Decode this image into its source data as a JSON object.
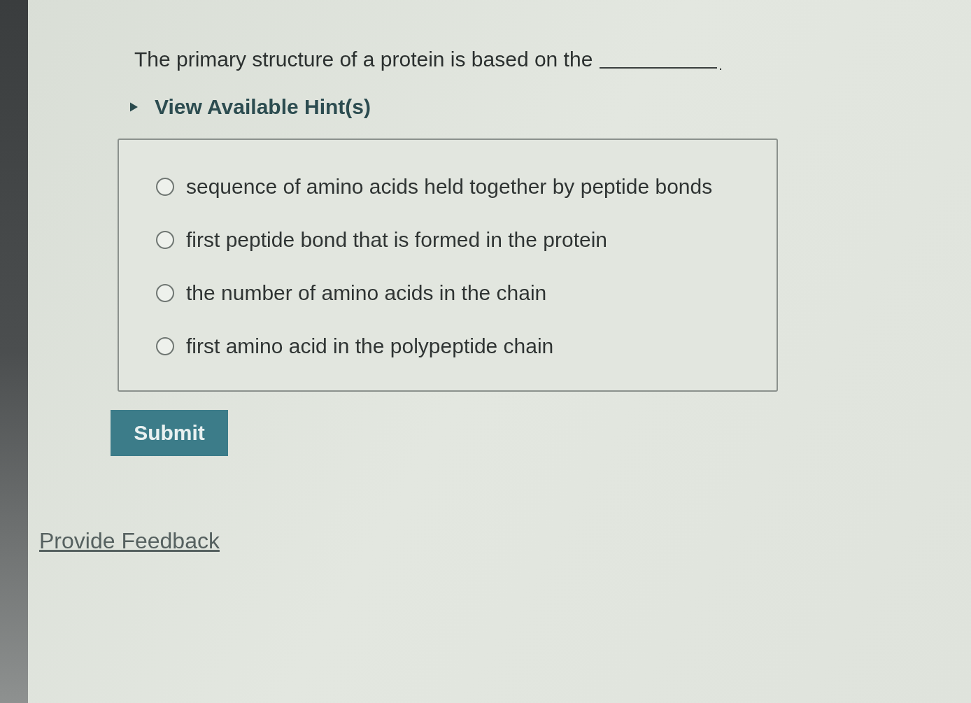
{
  "question": {
    "text": "The primary structure of a protein is based on the",
    "blank": true,
    "after_blank": "."
  },
  "hint_toggle": {
    "label": "View Available Hint(s)",
    "expanded": false
  },
  "options": [
    {
      "label": "sequence of amino acids held together by peptide bonds",
      "selected": false
    },
    {
      "label": "first peptide bond that is formed in the protein",
      "selected": false
    },
    {
      "label": "the number of amino acids in the chain",
      "selected": false
    },
    {
      "label": "first amino acid in the polypeptide chain",
      "selected": false
    }
  ],
  "submit_button": {
    "label": "Submit"
  },
  "feedback_link": {
    "label": "Provide Feedback"
  }
}
